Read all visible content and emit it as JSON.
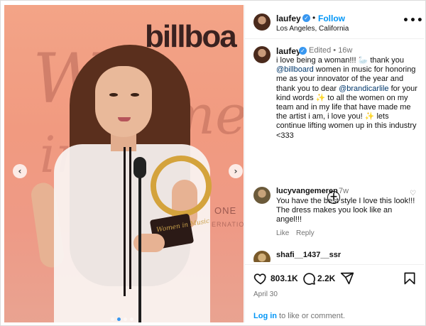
{
  "post": {
    "username": "laufey",
    "follow_label": "Follow",
    "location": "Los Angeles, California",
    "more_label": "•••"
  },
  "photo": {
    "sign_text": "billboa",
    "bg_word_1": "Wo",
    "bg_word_2": "me",
    "bg_word_3": "in",
    "bg_word_4": "ONE",
    "bg_word_5": "ERNATION",
    "award_text": "Women in Music"
  },
  "caption": {
    "username": "laufey",
    "edited": "Edited",
    "time": "16w",
    "text_1": "i love being a woman!!! 🦢 thank you ",
    "mention_1": "@billboard",
    "text_2": " women in music for honoring me as your innovator of the year and thank you to dear ",
    "mention_2": "@brandicarlile",
    "text_3": " for your kind words ✨ to all the women on my team and in my life that have made me the artist i am, i love you! ✨ lets continue lifting women up in this industry <333"
  },
  "comments": [
    {
      "username": "lucyvangemeren",
      "time": "7w",
      "text": "You have the best style I love this look!!! The dress makes you look like an angel!!!",
      "like_label": "Like",
      "reply_label": "Reply"
    },
    {
      "username": "shafi__1437__ssr"
    }
  ],
  "actions": {
    "likes": "803.1K",
    "comments": "2.2K",
    "date": "April 30",
    "login_link": "Log in",
    "login_text": " to like or comment."
  },
  "colors": {
    "accent": "#0095f6",
    "mention": "#00376b",
    "muted": "#737373"
  },
  "icons": [
    "verified-badge-icon",
    "more-icon",
    "add-icon",
    "heart-icon",
    "comment-icon",
    "share-icon",
    "bookmark-icon",
    "chevron-left-icon",
    "chevron-right-icon"
  ]
}
